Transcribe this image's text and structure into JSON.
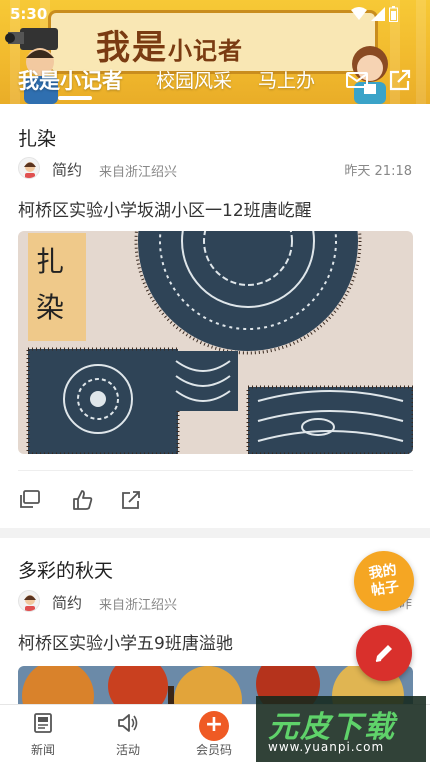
{
  "status_bar": {
    "time": "5:30"
  },
  "header": {
    "banner_title_big": "我是",
    "banner_title_small": "小记者",
    "tabs": [
      {
        "label": "我是小记者",
        "active": true
      },
      {
        "label": "校园风采",
        "active": false
      },
      {
        "label": "马上办",
        "active": false
      }
    ],
    "mail_icon": "mail-icon",
    "share_icon": "share-icon"
  },
  "posts": [
    {
      "title": "扎染",
      "author": "简约",
      "source": "来自浙江绍兴",
      "time": "昨天 21:18",
      "text": "柯桥区实验小学坂湖小区一12班唐屹醒",
      "image_label": "扎染",
      "actions": [
        "comment-icon",
        "like-icon",
        "share-icon"
      ]
    },
    {
      "title": "多彩的秋天",
      "author": "简约",
      "source": "来自浙江绍兴",
      "time": "昨",
      "text": "柯桥区实验小学五9班唐溢驰"
    }
  ],
  "fab": {
    "my_posts_label": "我的帖子",
    "edit_icon": "pencil-icon"
  },
  "bottom_nav": {
    "items": [
      {
        "label": "新闻",
        "icon": "newspaper-icon"
      },
      {
        "label": "活动",
        "icon": "speaker-icon"
      },
      {
        "label": "会员码",
        "icon": "plus-icon"
      }
    ]
  },
  "watermark": {
    "main": "元皮下载",
    "url": "www.yuanpi.com"
  },
  "colors": {
    "header_yellow": "#f1b92d",
    "accent_red": "#d9302c",
    "fab_orange": "#f5a623",
    "nav_orange": "#ef5a24",
    "denim_blue": "#2f4457"
  }
}
